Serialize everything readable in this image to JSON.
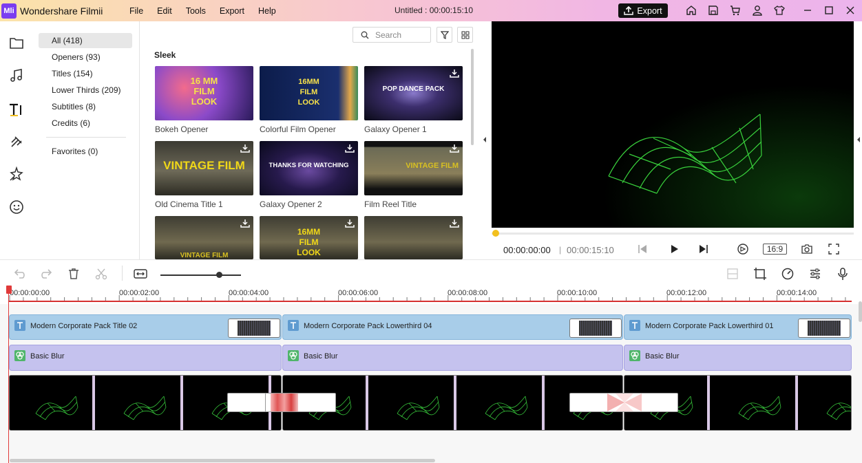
{
  "app": {
    "logo_text": "Mli",
    "name": "Wondershare Filmii",
    "doc_title": "Untitled :  00:00:15:10"
  },
  "menu": [
    "File",
    "Edit",
    "Tools",
    "Export",
    "Help"
  ],
  "export_label": "Export",
  "title_icons": [
    "home-icon",
    "save-icon",
    "cart-icon",
    "user-icon",
    "shirt-icon",
    "minimize-icon",
    "maximize-icon",
    "close-icon"
  ],
  "rail_icons": [
    "folder-icon",
    "music-icon",
    "title-icon",
    "transition-icon",
    "effects-icon",
    "sticker-icon"
  ],
  "categories": [
    {
      "label": "All (418)",
      "selected": true
    },
    {
      "label": "Openers (93)"
    },
    {
      "label": "Titles (154)"
    },
    {
      "label": "Lower Thirds (209)"
    },
    {
      "label": "Subtitles (8)"
    },
    {
      "label": "Credits (6)"
    }
  ],
  "favorites": "Favorites (0)",
  "search_placeholder": "Search",
  "section_title": "Sleek",
  "thumbs": [
    {
      "label": "Bokeh Opener",
      "text": "16 MM\nFILM\nLOOK"
    },
    {
      "label": "Colorful Film Opener",
      "text": "16MM\nFILM\nLOOK"
    },
    {
      "label": "Galaxy Opener 1",
      "text": "POP DANCE PACK"
    },
    {
      "label": "Old Cinema Title 1",
      "text": "VINTAGE FILM"
    },
    {
      "label": "Galaxy Opener 2",
      "text": "THANKS FOR WATCHING"
    },
    {
      "label": "Film Reel Title",
      "text": "VINTAGE FILM"
    },
    {
      "label": "",
      "text": "VINTAGE FILM"
    },
    {
      "label": "",
      "text": "16MM\nFILM\nLOOK"
    },
    {
      "label": "",
      "text": ""
    }
  ],
  "player": {
    "current": "00:00:00:00",
    "total": "00:00:15:10",
    "ratio": "16:9",
    "progress": 0
  },
  "zoom_level": 0.7,
  "ruler": [
    "00:00:00:00",
    "00:00:02:00",
    "00:00:04:00",
    "00:00:06:00",
    "00:00:08:00",
    "00:00:10:00",
    "00:00:12:00",
    "00:00:14:00"
  ],
  "title_clips": [
    "Modern Corporate Pack Title 02",
    "Modern Corporate Pack Lowerthird 04",
    "Modern Corporate Pack Lowerthird 01"
  ],
  "blur_clips": [
    "Basic Blur",
    "Basic Blur",
    "Basic Blur"
  ]
}
